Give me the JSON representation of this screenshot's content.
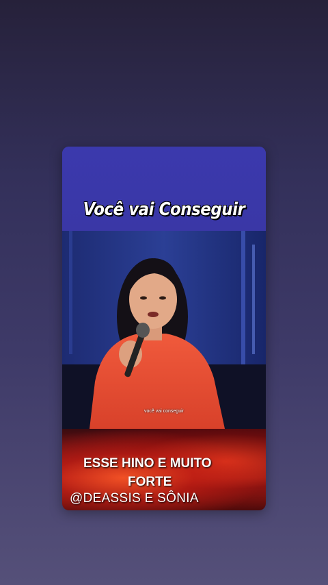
{
  "card": {
    "title": "Você vai Conseguir",
    "video_caption": "você vai conseguir",
    "banner": {
      "line1": "ESSE HINO E MUITO",
      "line2": "FORTE",
      "line3": "@DEASSIS E SÔNIA"
    }
  }
}
